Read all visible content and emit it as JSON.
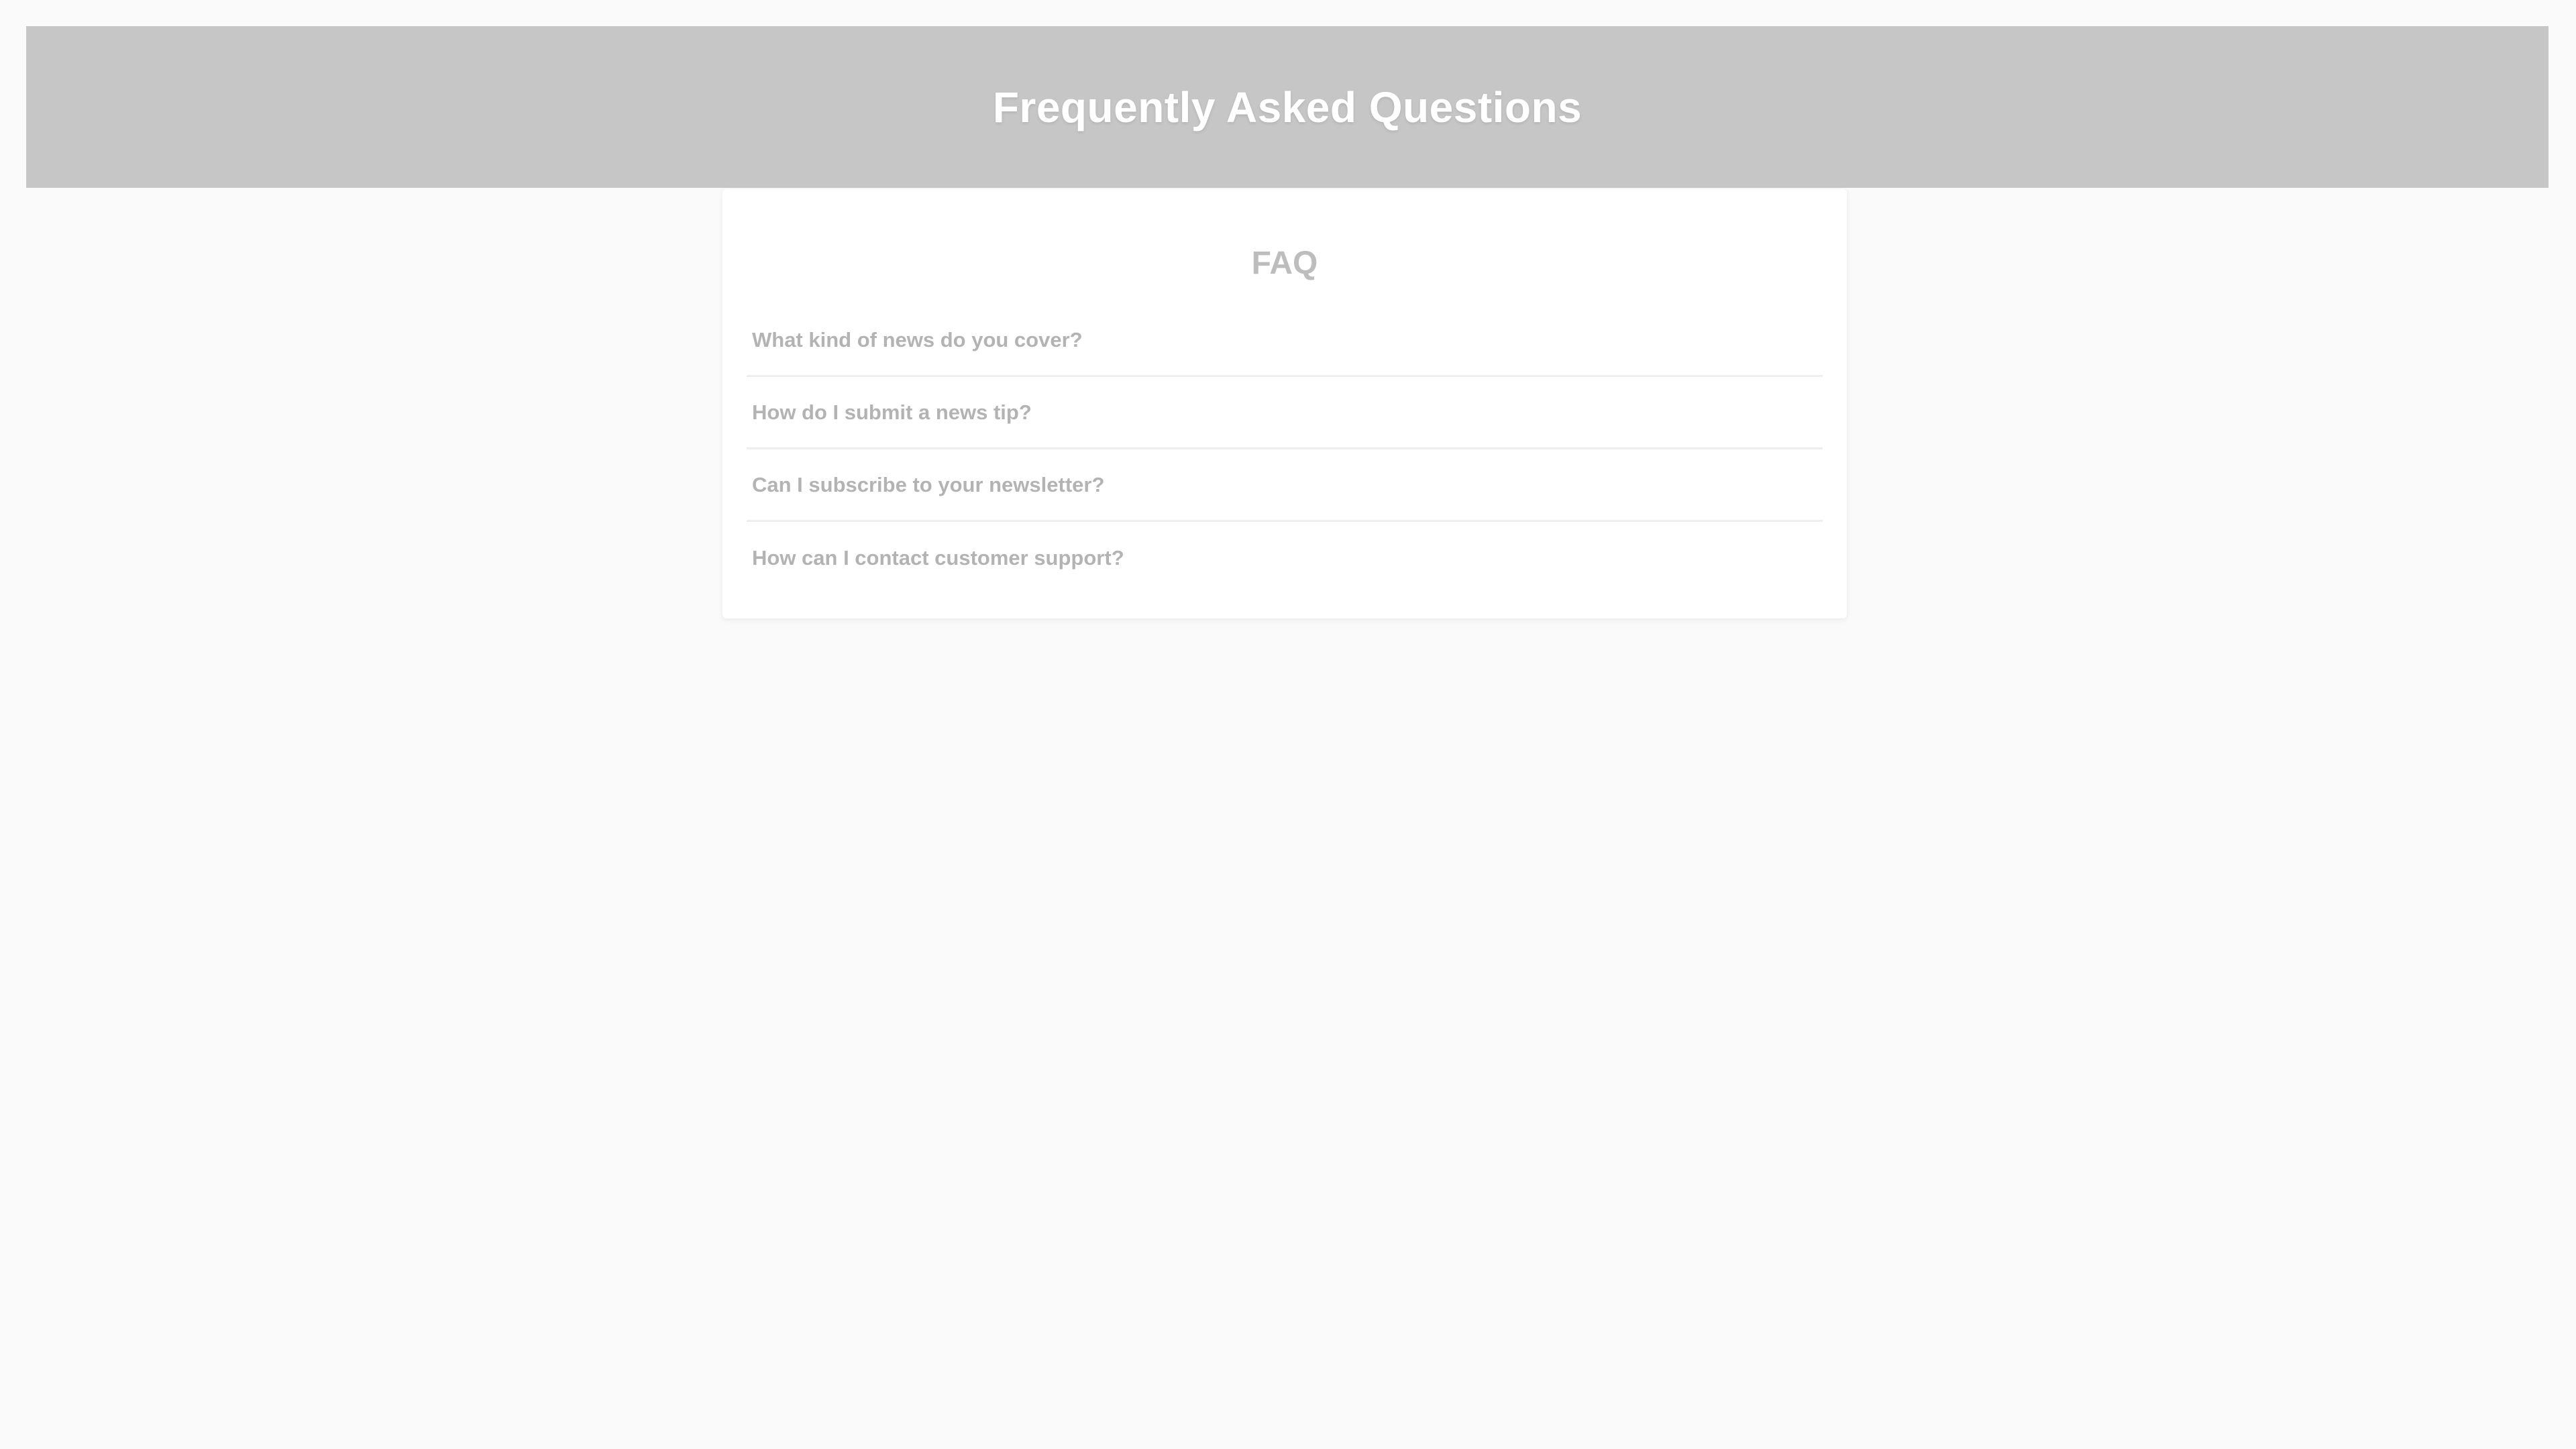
{
  "header": {
    "title": "Frequently Asked Questions"
  },
  "faq": {
    "heading": "FAQ",
    "items": [
      {
        "question": "What kind of news do you cover?"
      },
      {
        "question": "How do I submit a news tip?"
      },
      {
        "question": "Can I subscribe to your newsletter?"
      },
      {
        "question": "How can I contact customer support?"
      }
    ]
  },
  "colors": {
    "banner_background": "#c6c6c6",
    "page_background": "#fafafa",
    "card_background": "#ffffff",
    "heading_text": "#bdbdbd",
    "question_text": "#b3b3b3"
  }
}
